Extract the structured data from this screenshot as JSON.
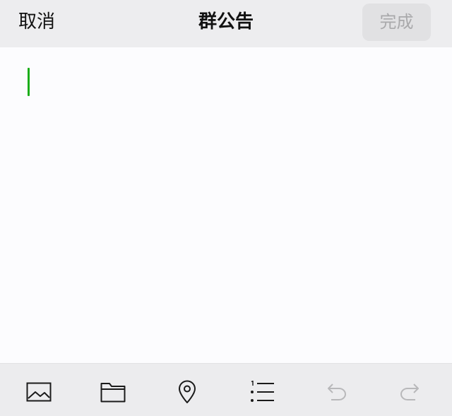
{
  "header": {
    "cancel_label": "取消",
    "title": "群公告",
    "done_label": "完成"
  },
  "editor": {
    "content": "",
    "caret_color": "#1aad19"
  },
  "toolbar": {
    "items": [
      {
        "icon": "image-icon",
        "enabled": true
      },
      {
        "icon": "folder-icon",
        "enabled": true
      },
      {
        "icon": "location-pin-icon",
        "enabled": true
      },
      {
        "icon": "numbered-list-icon",
        "enabled": true
      },
      {
        "icon": "undo-icon",
        "enabled": false
      },
      {
        "icon": "redo-icon",
        "enabled": false
      }
    ]
  },
  "colors": {
    "header_bg": "#ededef",
    "done_bg": "#e1e1e3",
    "done_text_disabled": "#a9a9ab",
    "accent": "#1aad19",
    "icon_active": "#1a1a1a",
    "icon_disabled": "#b8b8ba"
  }
}
